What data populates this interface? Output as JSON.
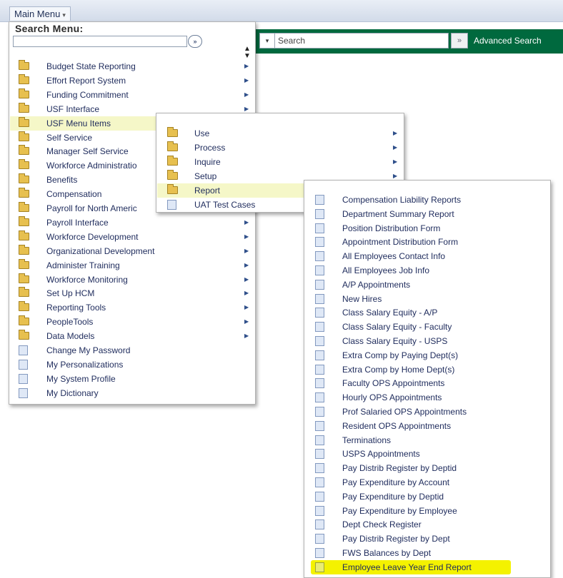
{
  "topbar": {
    "main_menu_label": "Main Menu",
    "search_placeholder": "Search",
    "advanced_search_label": "Advanced Search",
    "go_glyph": "»"
  },
  "menu": {
    "search_title": "Search Menu:",
    "search_go_glyph": "»",
    "items": [
      {
        "label": "Budget State Reporting",
        "icon": "folder-icon",
        "submenu": true
      },
      {
        "label": "Effort Report System",
        "icon": "folder-icon",
        "submenu": true
      },
      {
        "label": "Funding Commitment",
        "icon": "folder-icon",
        "submenu": true
      },
      {
        "label": "USF Interface",
        "icon": "folder-icon",
        "submenu": true
      },
      {
        "label": "USF Menu Items",
        "icon": "folder-icon",
        "submenu": true
      },
      {
        "label": "Self Service",
        "icon": "folder-icon",
        "submenu": true
      },
      {
        "label": "Manager Self Service",
        "icon": "folder-icon",
        "submenu": true
      },
      {
        "label": "Workforce Administratio",
        "icon": "folder-icon",
        "submenu": true
      },
      {
        "label": "Benefits",
        "icon": "folder-icon",
        "submenu": true
      },
      {
        "label": "Compensation",
        "icon": "folder-icon",
        "submenu": true
      },
      {
        "label": "Payroll for North Americ",
        "icon": "folder-icon",
        "submenu": true
      },
      {
        "label": "Payroll Interface",
        "icon": "folder-icon",
        "submenu": true
      },
      {
        "label": "Workforce Development",
        "icon": "folder-icon",
        "submenu": true
      },
      {
        "label": "Organizational Development",
        "icon": "folder-icon",
        "submenu": true
      },
      {
        "label": "Administer Training",
        "icon": "folder-icon",
        "submenu": true
      },
      {
        "label": "Workforce Monitoring",
        "icon": "folder-icon",
        "submenu": true
      },
      {
        "label": "Set Up HCM",
        "icon": "folder-icon",
        "submenu": true
      },
      {
        "label": "Reporting Tools",
        "icon": "folder-icon",
        "submenu": true
      },
      {
        "label": "PeopleTools",
        "icon": "folder-icon",
        "submenu": true
      },
      {
        "label": "Data Models",
        "icon": "folder-icon",
        "submenu": true
      },
      {
        "label": "Change My Password",
        "icon": "page-icon",
        "submenu": false
      },
      {
        "label": "My Personalizations",
        "icon": "page-icon",
        "submenu": false
      },
      {
        "label": "My System Profile",
        "icon": "page-icon",
        "submenu": false
      },
      {
        "label": "My Dictionary",
        "icon": "page-icon",
        "submenu": false
      }
    ],
    "active_item": "USF Menu Items"
  },
  "usf_submenu": {
    "items": [
      {
        "label": "Use",
        "icon": "folder-icon",
        "submenu": true
      },
      {
        "label": "Process",
        "icon": "folder-icon",
        "submenu": true
      },
      {
        "label": "Inquire",
        "icon": "folder-icon",
        "submenu": true
      },
      {
        "label": "Setup",
        "icon": "folder-icon",
        "submenu": true
      },
      {
        "label": "Report",
        "icon": "folder-icon",
        "submenu": true
      },
      {
        "label": "UAT Test Cases",
        "icon": "page-icon",
        "submenu": false
      }
    ],
    "active_item": "Report"
  },
  "report_submenu": {
    "items": [
      "Compensation Liability Reports",
      "Department Summary Report",
      "Position Distribution Form",
      "Appointment Distribution Form",
      "All Employees Contact Info",
      "All Employees Job Info",
      "A/P Appointments",
      "New Hires",
      "Class Salary Equity - A/P",
      "Class Salary Equity - Faculty",
      "Class Salary Equity - USPS",
      "Extra Comp by Paying Dept(s)",
      "Extra Comp by Home Dept(s)",
      "Faculty OPS Appointments",
      "Hourly OPS Appointments",
      "Prof Salaried OPS Appointments",
      "Resident OPS Appointments",
      "Terminations",
      "USPS Appointments",
      "Pay Distrib Register by Deptid",
      "Pay Expenditure by Account",
      "Pay Expenditure by Deptid",
      "Pay Expenditure by Employee",
      "Dept Check Register",
      "Pay Distrib Register by Dept",
      "FWS Balances by Dept",
      "Employee Leave Year End Report"
    ],
    "highlighted_item": "Employee Leave Year End Report"
  },
  "colors": {
    "green_bar": "#00693e",
    "link_text": "#1e2b5c",
    "hover_row": "#f5f7c8",
    "yellow_highlight": "#f4f200"
  }
}
